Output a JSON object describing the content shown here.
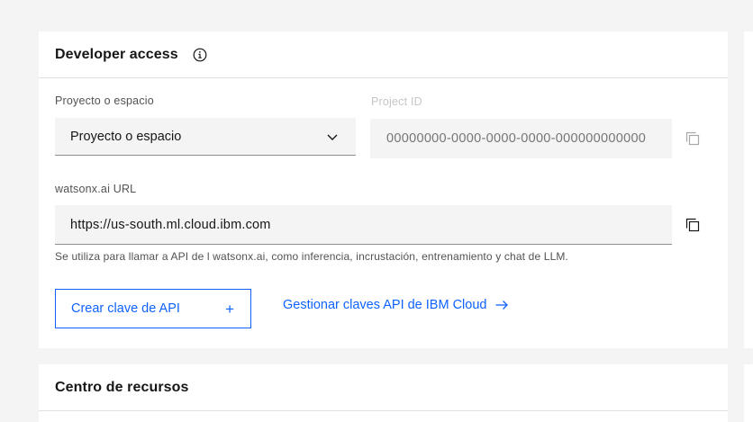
{
  "developer_access": {
    "title": "Developer access",
    "project_label": "Proyecto o espacio",
    "project_selected": "Proyecto o espacio",
    "project_id_label": "Project ID",
    "project_id_placeholder": "00000000-0000-0000-0000-000000000000",
    "url_label": "watsonx.ai URL",
    "url_value": "https://us-south.ml.cloud.ibm.com",
    "url_helper": "Se utiliza para llamar a API de l watsonx.ai, como inferencia, incrustación, entrenamiento y chat de LLM.",
    "create_key_label": "Crear clave de API",
    "create_key_icon": "+",
    "manage_keys_label": "Gestionar claves API de IBM Cloud"
  },
  "resources": {
    "title": "Centro de recursos"
  },
  "colors": {
    "accent": "#0f62fe",
    "background": "#f4f4f4",
    "card": "#ffffff"
  },
  "icons": {
    "info": "information-icon",
    "dropdown": "chevron-down-icon",
    "copy": "copy-icon",
    "plus": "plus-icon",
    "arrow": "arrow-right-icon"
  }
}
